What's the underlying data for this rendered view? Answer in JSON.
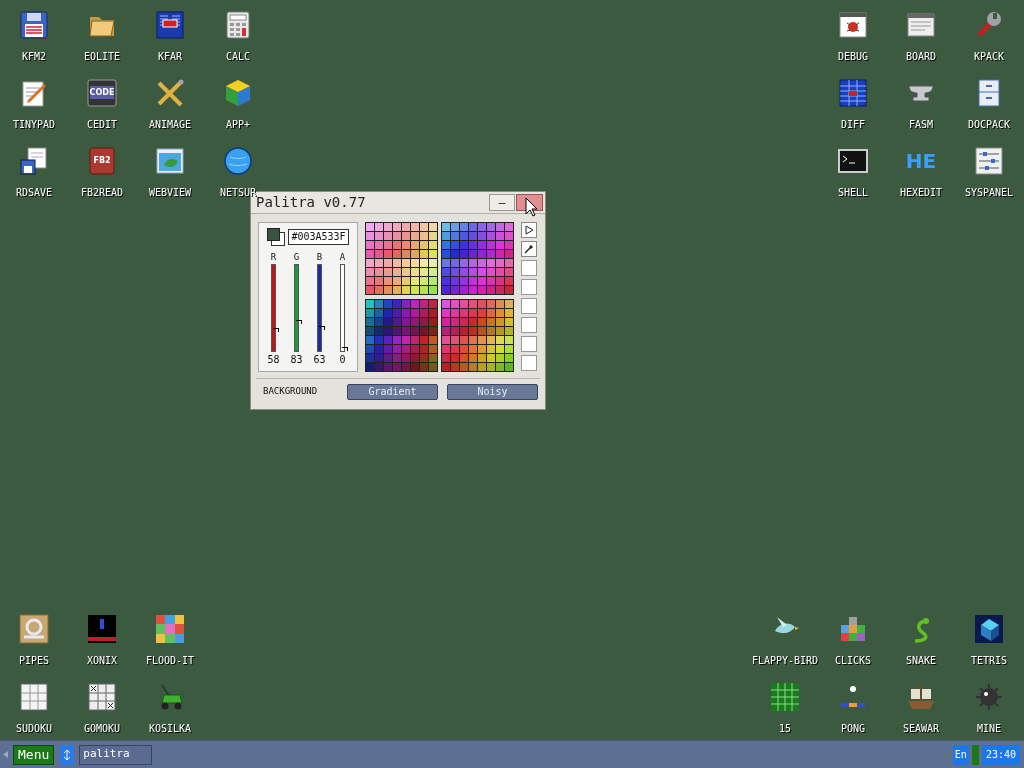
{
  "desktop_icons": {
    "top_left": [
      {
        "label": "KFM2"
      },
      {
        "label": "EOLITE"
      },
      {
        "label": "KFAR"
      },
      {
        "label": "CALC"
      },
      {
        "label": "TINYPAD"
      },
      {
        "label": "CEDIT",
        "icon": {
          "text": "CODE"
        }
      },
      {
        "label": "ANIMAGE"
      },
      {
        "label": "APP+"
      },
      {
        "label": "RDSAVE"
      },
      {
        "label": "FB2READ",
        "icon": {
          "text": "FB2"
        }
      },
      {
        "label": "WEBVIEW"
      },
      {
        "label": "NETSUR"
      }
    ],
    "top_right": [
      {
        "row": [
          {
            "label": "DEBUG"
          },
          {
            "label": "BOARD"
          },
          {
            "label": "KPACK"
          }
        ]
      },
      {
        "row": [
          {
            "label": "DIFF"
          },
          {
            "label": "FASM"
          },
          {
            "label": "DOCPACK"
          }
        ]
      },
      {
        "row": [
          {
            "label": "SHELL"
          },
          {
            "label": "HEXEDIT",
            "icon": {
              "text": "HE"
            }
          },
          {
            "label": "SYSPANEL"
          }
        ]
      }
    ],
    "bottom_left": [
      {
        "label": "PIPES"
      },
      {
        "label": "XONIX"
      },
      {
        "label": "FLOOD-IT"
      },
      {
        "label": "SUDOKU"
      },
      {
        "label": "GOMOKU"
      },
      {
        "label": "KOSILKA"
      }
    ],
    "bottom_right": [
      {
        "label": "FLAPPY-BIRD"
      },
      {
        "label": "CLICKS"
      },
      {
        "label": "SNAKE"
      },
      {
        "label": "TETRIS"
      },
      {
        "label": "15"
      },
      {
        "label": "PONG"
      },
      {
        "label": "SEAWAR"
      },
      {
        "label": "MINE"
      }
    ]
  },
  "window": {
    "title": "Palitra v0.77",
    "minimize": "–",
    "hex_value": "#003A533F",
    "channels": [
      {
        "name": "R",
        "reading": "58",
        "level": 0.227,
        "color": "#c0141c"
      },
      {
        "name": "G",
        "reading": "83",
        "level": 0.325,
        "color": "#1a9a3a"
      },
      {
        "name": "B",
        "reading": "63",
        "level": 0.247,
        "color": "#1a2aa8"
      },
      {
        "name": "A",
        "reading": "0",
        "level": 0,
        "color": "#ffffff"
      }
    ],
    "background_label": "BACKGROUND",
    "buttons": [
      "Gradient",
      "Noisy"
    ]
  },
  "taskbar": {
    "menu": "Menu",
    "task": "palitra",
    "language": "En",
    "time": "23:40"
  }
}
